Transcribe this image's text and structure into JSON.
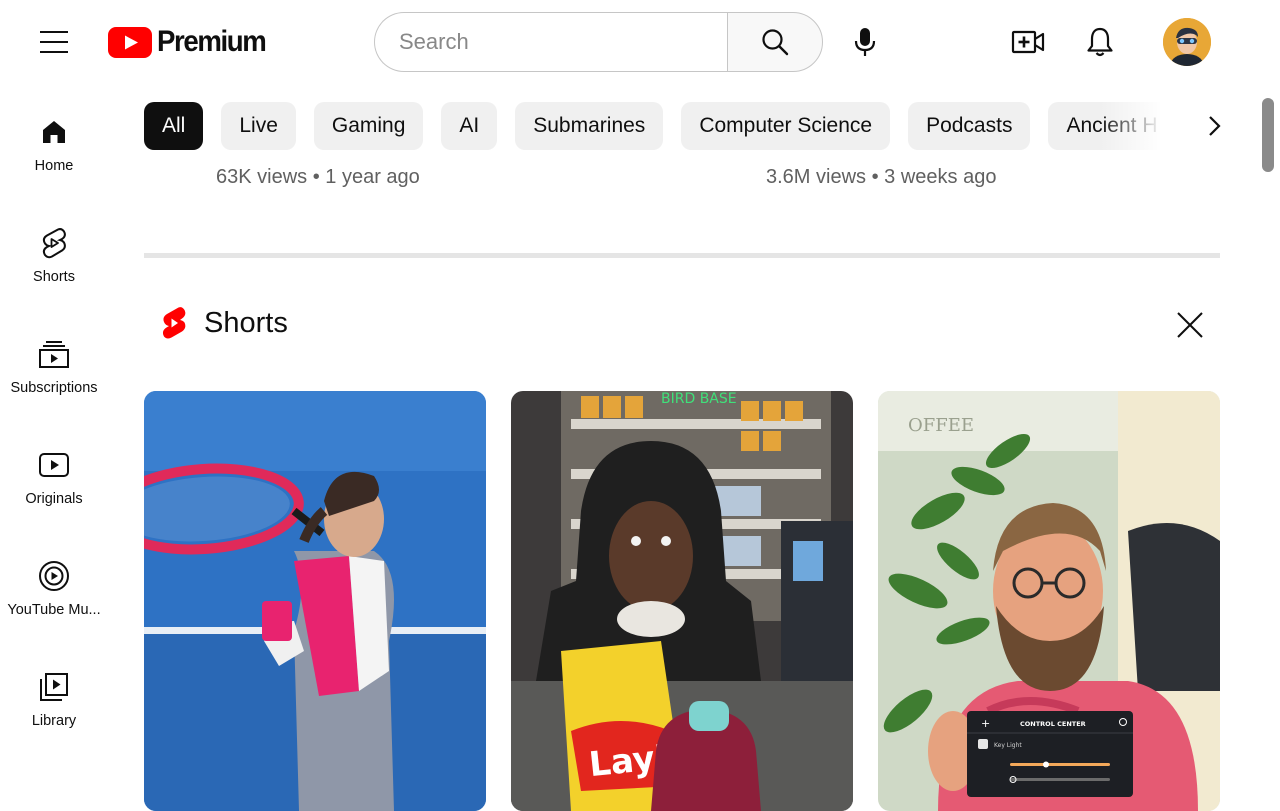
{
  "header": {
    "logo_text": "Premium",
    "search_placeholder": "Search",
    "brand_color": "#ff0000"
  },
  "sidebar": {
    "items": [
      {
        "label": "Home",
        "icon": "home-icon"
      },
      {
        "label": "Shorts",
        "icon": "shorts-icon"
      },
      {
        "label": "Subscriptions",
        "icon": "subscriptions-icon"
      },
      {
        "label": "Originals",
        "icon": "originals-icon"
      },
      {
        "label": "YouTube Mu...",
        "icon": "youtube-music-icon"
      },
      {
        "label": "Library",
        "icon": "library-icon"
      }
    ]
  },
  "chips": [
    "All",
    "Live",
    "Gaming",
    "AI",
    "Submarines",
    "Computer Science",
    "Podcasts",
    "Ancient H"
  ],
  "videos": [
    {
      "views": "63K views",
      "age": "1 year ago"
    },
    {
      "views": "3.6M views",
      "age": "3 weeks ago"
    }
  ],
  "shorts_shelf": {
    "title": "Shorts",
    "cards": [
      {
        "description": "tennis-player-thumbnail"
      },
      {
        "description": "store-chips-thumbnail",
        "visible_text": "Lay's"
      },
      {
        "description": "control-center-thumbnail",
        "overlay_title": "CONTROL CENTER",
        "overlay_item": "Key Light"
      }
    ]
  }
}
